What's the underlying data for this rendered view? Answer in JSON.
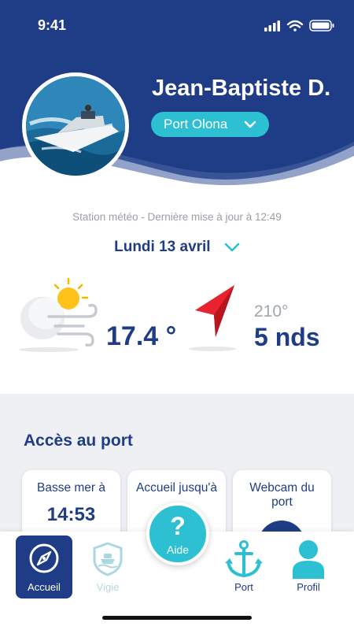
{
  "status_bar": {
    "time": "9:41"
  },
  "colors": {
    "navy": "#1f3c86",
    "teal": "#2cc0d2",
    "gray_bg": "#eef0f3",
    "red_arrow": "#e8232f"
  },
  "profile": {
    "name": "Jean-Baptiste D.",
    "port": "Port Olona",
    "avatar_icon": "boat-photo"
  },
  "weather": {
    "station": "Station météo - Dernière mise à jour à 12:49",
    "date": "Lundi 13 avril",
    "temperature": "17.4 °",
    "icon": "cloud-sun-wind-icon",
    "wind_direction": "210°",
    "wind_speed": "5 nds",
    "wind_icon": "navigation-arrow-icon"
  },
  "port_access": {
    "title": "Accès au port",
    "cards": [
      {
        "label": "Basse mer à",
        "value": "14:53"
      },
      {
        "label": "Accueil jusqu'à",
        "value": ""
      },
      {
        "label": "Webcam du port",
        "value": ""
      }
    ]
  },
  "nav": {
    "items": [
      {
        "label": "Accueil",
        "icon": "compass-icon",
        "active": true
      },
      {
        "label": "Vigie",
        "icon": "shield-boat-icon",
        "active": false
      },
      {
        "label": "Port",
        "icon": "anchor-icon",
        "active": false
      },
      {
        "label": "Profil",
        "icon": "person-icon",
        "active": false
      }
    ],
    "help": {
      "symbol": "?",
      "label": "Aide"
    }
  }
}
